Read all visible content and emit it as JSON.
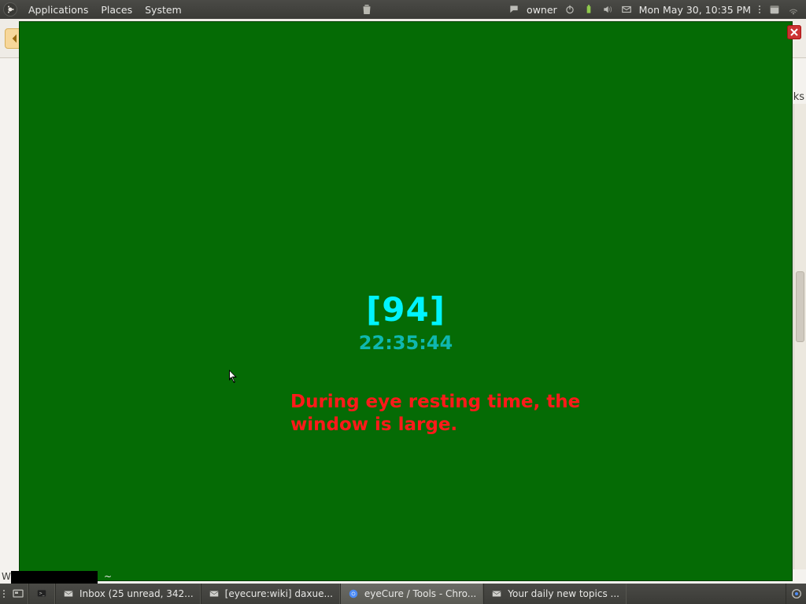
{
  "top_panel": {
    "menus": {
      "applications": "Applications",
      "places": "Places",
      "system": "System"
    },
    "user": "owner",
    "clock": "Mon May 30, 10:35 PM"
  },
  "eyecure": {
    "counter": "[94]",
    "time": "22:35:44",
    "message": "During eye resting time, the window is large."
  },
  "browser_hints": {
    "bookmarks_suffix": "ks",
    "status_prefix": "Wa"
  },
  "terminal_hint": {
    "tilde": "~"
  },
  "taskbar": {
    "items": [
      {
        "label": "Inbox (25 unread, 342...",
        "icon": "mail"
      },
      {
        "label": "[eyecure:wiki] daxue...",
        "icon": "mail"
      },
      {
        "label": "eyeCure / Tools - Chro...",
        "icon": "chrome",
        "active": true
      },
      {
        "label": "Your daily new topics ...",
        "icon": "mail"
      }
    ]
  }
}
